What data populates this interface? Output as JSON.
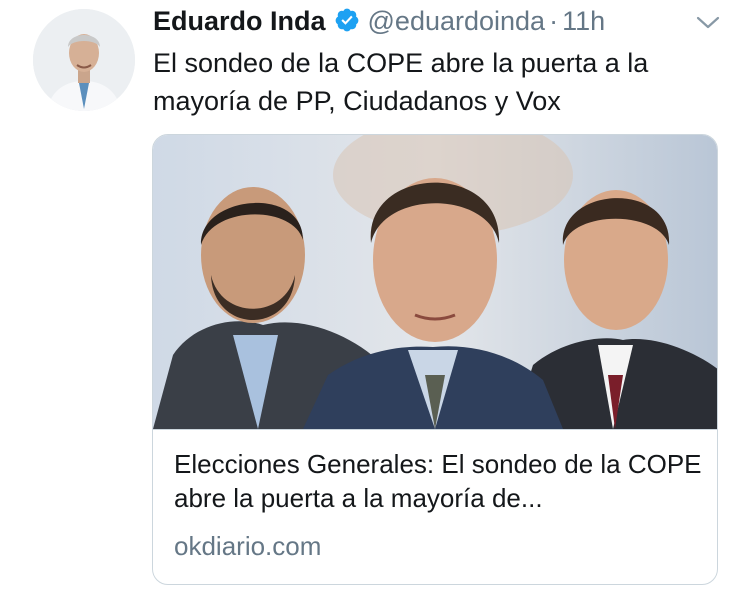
{
  "tweet": {
    "author": {
      "display_name": "Eduardo Inda",
      "handle": "@eduardoinda",
      "verified": true,
      "avatar_icon": "profile-photo"
    },
    "separator": "·",
    "time": "11h",
    "text": "El sondeo de la COPE abre la puerta a la mayoría de PP, Ciudadanos y Vox",
    "card": {
      "title": "Elecciones Generales: El sondeo de la COPE abre la puerta a la mayoría de...",
      "domain": "okdiario.com",
      "image_icon": "three-politicians-photo"
    }
  },
  "colors": {
    "verified_blue": "#1da1f2",
    "secondary_text": "#657786",
    "primary_text": "#14171a",
    "border": "#ccd6dd"
  }
}
